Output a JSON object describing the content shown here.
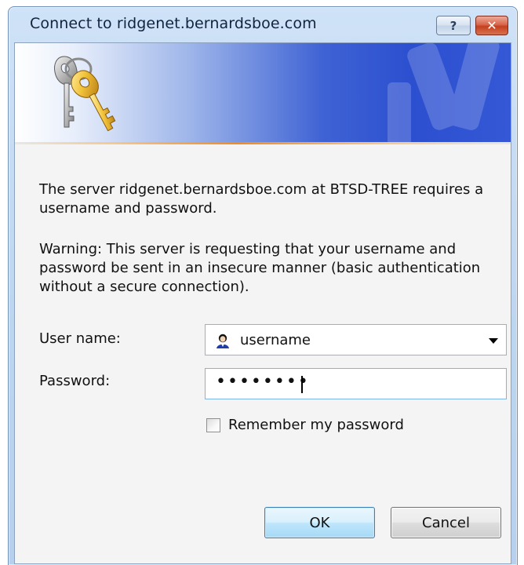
{
  "window": {
    "title": "Connect to ridgenet.bernardsboe.com",
    "help_glyph": "?",
    "close_glyph": "✕"
  },
  "banner": {
    "icon": "keys-icon",
    "accent_line_color": "#f08a23"
  },
  "message": {
    "info": "The server ridgenet.bernardsboe.com at BTSD-TREE requires a username and password.",
    "warning": "Warning: This server is requesting that your username and password be sent in an insecure manner (basic authentication without a secure connection)."
  },
  "form": {
    "username_label": "User name:",
    "username_value": "username",
    "username_icon": "user-icon",
    "password_label": "Password:",
    "password_value": "••••••••",
    "remember_label": "Remember my password",
    "remember_checked": false
  },
  "buttons": {
    "ok": "OK",
    "cancel": "Cancel"
  }
}
